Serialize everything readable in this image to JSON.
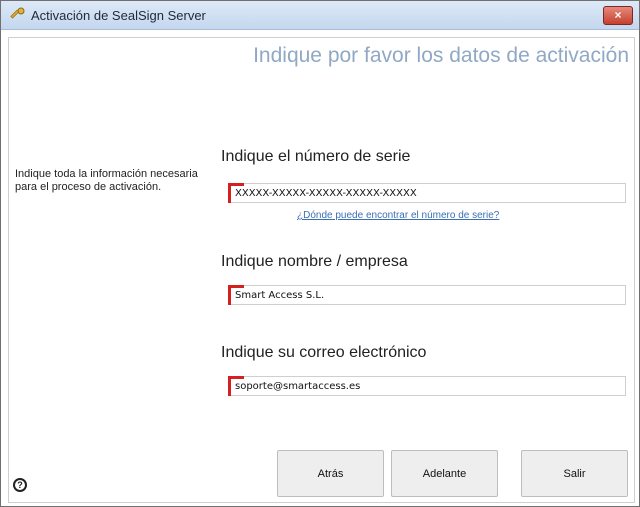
{
  "window": {
    "title": "Activación de SealSign Server",
    "close_label": "×"
  },
  "sidebar": {
    "description": "Indique toda la información necesaria para el proceso de activación.",
    "help_glyph": "?"
  },
  "main": {
    "heading": "Indique por favor los datos de activación",
    "serial": {
      "label": "Indique el número de serie",
      "value": "XXXXX-XXXXX-XXXXX-XXXXX-XXXXX",
      "help_link": "¿Dónde puede encontrar el número de serie?"
    },
    "name": {
      "label": "Indique nombre / empresa",
      "value": "Smart Access S.L."
    },
    "email": {
      "label": "Indique su correo electrónico",
      "value": "soporte@smartaccess.es"
    }
  },
  "buttons": {
    "back": "Atrás",
    "next": "Adelante",
    "exit": "Salir"
  },
  "colors": {
    "heading": "#8fa9c5",
    "field_marker": "#d62020",
    "link": "#3a6fb3"
  }
}
